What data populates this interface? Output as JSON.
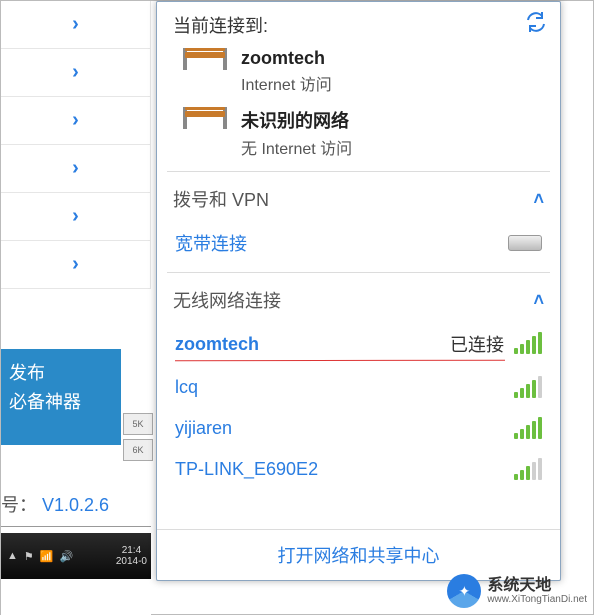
{
  "left_panel": {
    "published": "发布",
    "tool": "必备神器",
    "version_prefix": "号：",
    "version": "V1.0.2.6",
    "thumb1": "5K",
    "thumb2": "6K"
  },
  "taskbar": {
    "time": "21:4",
    "date": "2014-0"
  },
  "flyout": {
    "header": "当前连接到:",
    "connections": [
      {
        "name": "zoomtech",
        "sub": "Internet 访问"
      },
      {
        "name": "未识别的网络",
        "sub": "无 Internet 访问"
      }
    ],
    "dial_section": "拨号和 VPN",
    "broadband": "宽带连接",
    "wifi_section": "无线网络连接",
    "wifi": [
      {
        "name": "zoomtech",
        "status": "已连接",
        "bars": 5,
        "connected": true
      },
      {
        "name": "lcq",
        "status": "",
        "bars": 4,
        "connected": false
      },
      {
        "name": "yijiaren",
        "status": "",
        "bars": 5,
        "connected": false
      },
      {
        "name": "TP-LINK_E690E2",
        "status": "",
        "bars": 3,
        "connected": false
      }
    ],
    "footer_link": "打开网络和共享中心"
  },
  "watermark": {
    "line1": "系统天地",
    "line2": "www.XiTongTianDi.net"
  }
}
